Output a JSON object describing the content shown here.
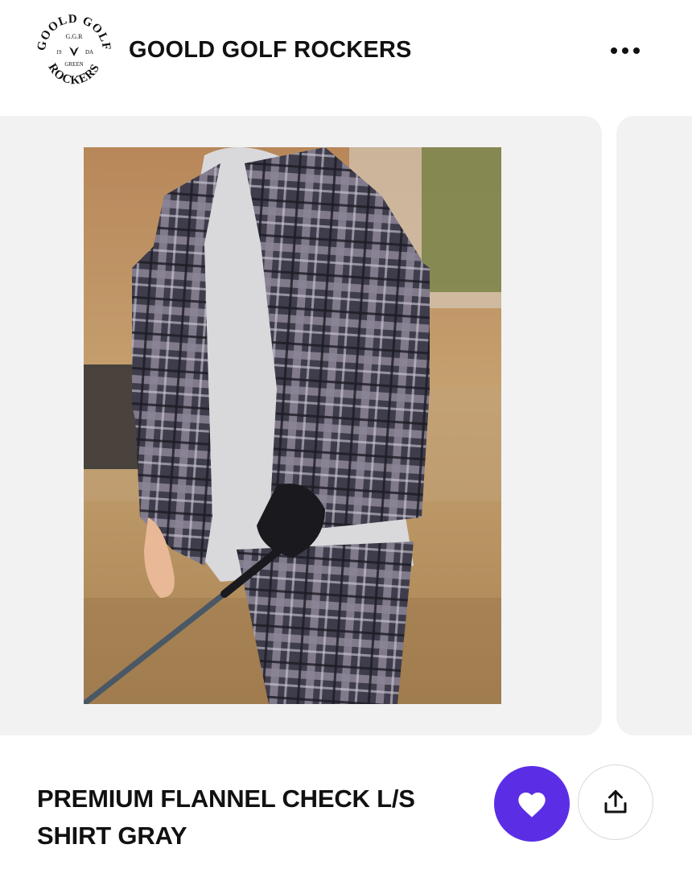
{
  "header": {
    "shop_name": "GOOLD GOLF ROCKERS",
    "logo": {
      "arc_top": "GOOLD GOLF",
      "arc_bottom": "ROCKERS",
      "line1": "G.G.R",
      "left": "19",
      "right": "DA",
      "line3": "GREEN"
    },
    "more_icon": "more-horizontal-icon"
  },
  "product": {
    "title": "PREMIUM FLANNEL CHECK L/S SHIRT GRAY",
    "image_alt": "Model wearing gray plaid flannel shirt over gray hoodie holding a golf club"
  },
  "actions": {
    "favorite_icon": "heart-icon",
    "share_icon": "share-icon"
  },
  "colors": {
    "accent": "#5b2ee6",
    "card_bg": "#f2f2f2"
  }
}
